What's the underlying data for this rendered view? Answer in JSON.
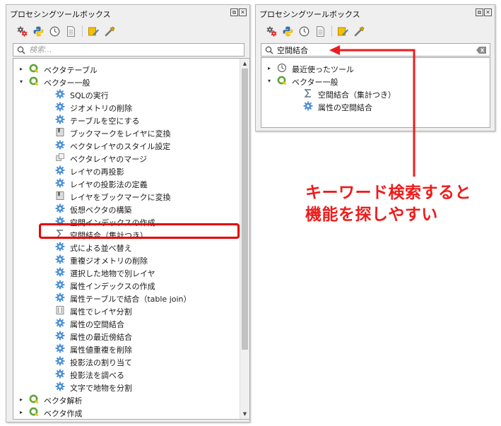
{
  "left_panel": {
    "title": "プロセシングツールボックス",
    "window_buttons": [
      "⧉",
      "✕"
    ],
    "search_placeholder": "検索...",
    "tree": [
      {
        "label": "ベクタテーブル",
        "icon": "qgis-group-icon",
        "arrow": "▸",
        "indent": 0
      },
      {
        "label": "ベクター一般",
        "icon": "qgis-group-icon",
        "arrow": "▾",
        "indent": 0
      },
      {
        "label": "SQLの実行",
        "icon": "gear-icon",
        "indent": 1
      },
      {
        "label": "ジオメトリの削除",
        "icon": "gear-icon",
        "indent": 1
      },
      {
        "label": "テーブルを空にする",
        "icon": "gear-icon",
        "indent": 1
      },
      {
        "label": "ブックマークをレイヤに変換",
        "icon": "bookmark-icon",
        "indent": 1
      },
      {
        "label": "ベクタレイヤのスタイル設定",
        "icon": "gear-icon",
        "indent": 1
      },
      {
        "label": "ベクタレイヤのマージ",
        "icon": "merge-icon",
        "indent": 1
      },
      {
        "label": "レイヤの再投影",
        "icon": "gear-icon",
        "indent": 1
      },
      {
        "label": "レイヤの投影法の定義",
        "icon": "gear-icon",
        "indent": 1
      },
      {
        "label": "レイヤをブックマークに変換",
        "icon": "bookmark-icon",
        "indent": 1
      },
      {
        "label": "仮想ベクタの構築",
        "icon": "gear-icon",
        "indent": 1
      },
      {
        "label": "空間インデックスの作成",
        "icon": "gear-icon",
        "indent": 1
      },
      {
        "label": "空間結合（集計つき）",
        "icon": "sigma-icon",
        "indent": 1
      },
      {
        "label": "式による並べ替え",
        "icon": "gear-icon",
        "indent": 1
      },
      {
        "label": "重複ジオメトリの削除",
        "icon": "gear-icon",
        "indent": 1
      },
      {
        "label": "選択した地物で別レイヤ",
        "icon": "gear-icon",
        "indent": 1
      },
      {
        "label": "属性インデックスの作成",
        "icon": "gear-icon",
        "indent": 1
      },
      {
        "label": "属性テーブルで結合（table join）",
        "icon": "gear-icon",
        "indent": 1
      },
      {
        "label": "属性でレイヤ分割",
        "icon": "split-icon",
        "indent": 1
      },
      {
        "label": "属性の空間結合",
        "icon": "gear-icon",
        "indent": 1
      },
      {
        "label": "属性の最近傍結合",
        "icon": "gear-icon",
        "indent": 1
      },
      {
        "label": "属性値重複を削除",
        "icon": "gear-icon",
        "indent": 1
      },
      {
        "label": "投影法の割り当て",
        "icon": "gear-icon",
        "indent": 1
      },
      {
        "label": "投影法を調べる",
        "icon": "gear-icon",
        "indent": 1
      },
      {
        "label": "文字で地物を分割",
        "icon": "gear-icon",
        "indent": 1
      },
      {
        "label": "ベクタ解析",
        "icon": "qgis-group-icon",
        "arrow": "▸",
        "indent": 0
      },
      {
        "label": "ベクタ作成",
        "icon": "qgis-group-icon",
        "arrow": "▸",
        "indent": 0
      }
    ]
  },
  "right_panel": {
    "title": "プロセシングツールボックス",
    "window_buttons": [
      "⧉",
      "✕"
    ],
    "search_value": "空間結合",
    "tree": [
      {
        "label": "最近使ったツール",
        "icon": "clock-icon",
        "arrow": "▸",
        "indent": 0
      },
      {
        "label": "ベクター一般",
        "icon": "qgis-group-icon",
        "arrow": "▾",
        "indent": 0
      },
      {
        "label": "空間結合（集計つき）",
        "icon": "sigma-icon",
        "indent": 1
      },
      {
        "label": "属性の空間結合",
        "icon": "gear-icon",
        "indent": 1
      }
    ]
  },
  "toolbar_icons": [
    "models-icon",
    "python-icon",
    "history-icon",
    "results-icon",
    "edit-features-icon",
    "options-icon"
  ],
  "annotation": {
    "line1": "キーワード検索すると",
    "line2": "機能を探しやすい",
    "color": "#ee1c1c"
  },
  "highlight_color": "#e60000"
}
